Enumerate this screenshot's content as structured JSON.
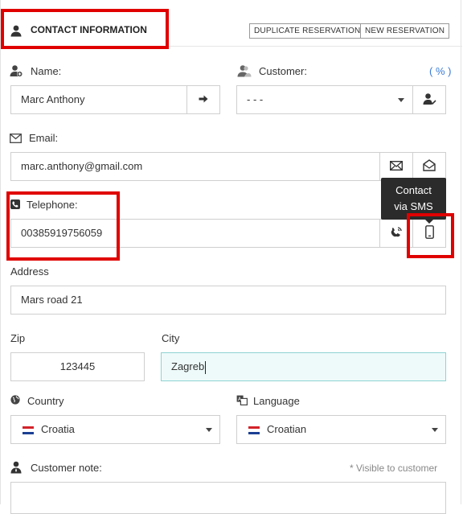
{
  "header": {
    "title": "CONTACT INFORMATION",
    "duplicate_label": "DUPLICATE RESERVATION",
    "new_label": "NEW RESERVATION"
  },
  "name": {
    "label": "Name:",
    "value": "Marc Anthony"
  },
  "customer": {
    "label": "Customer:",
    "percent_link": "( % )",
    "selected": "- - -"
  },
  "email": {
    "label": "Email:",
    "value": "marc.anthony@gmail.com"
  },
  "telephone": {
    "label": "Telephone:",
    "value": "00385919756059"
  },
  "tooltip": {
    "line1": "Contact",
    "line2": "via SMS"
  },
  "address": {
    "label": "Address",
    "value": "Mars road 21"
  },
  "zip": {
    "label": "Zip",
    "value": "123445"
  },
  "city": {
    "label": "City",
    "value": "Zagreb"
  },
  "country": {
    "label": "Country",
    "selected": "Croatia"
  },
  "language": {
    "label": "Language",
    "selected": "Croatian"
  },
  "note": {
    "label": "Customer note:",
    "hint": "* Visible to customer"
  },
  "colors": {
    "highlight": "#e00000",
    "link": "#3a7bd5",
    "focus_bg": "#eefafa",
    "focus_border": "#8fd3d3",
    "tooltip_bg": "#2b2b2b"
  },
  "icons": [
    "user-icon",
    "user-add-icon",
    "arrow-right-icon",
    "customer-icon",
    "user-check-icon",
    "envelope-icon",
    "envelope-open-icon",
    "phone-icon",
    "phone-call-icon",
    "mobile-icon",
    "globe-icon",
    "language-icon",
    "note-user-icon"
  ]
}
